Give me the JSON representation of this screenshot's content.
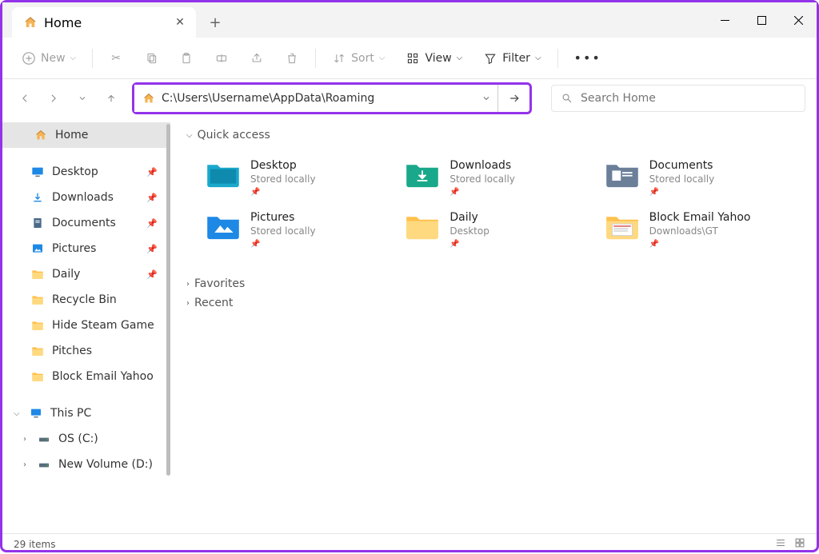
{
  "tab": {
    "title": "Home"
  },
  "toolbar": {
    "new": "New",
    "sort": "Sort",
    "view": "View",
    "filter": "Filter"
  },
  "address": {
    "path": "C:\\Users\\Username\\AppData\\Roaming"
  },
  "search": {
    "placeholder": "Search Home"
  },
  "sidebar": {
    "home": "Home",
    "pinned": [
      {
        "label": "Desktop",
        "icon": "desktop"
      },
      {
        "label": "Downloads",
        "icon": "downloads"
      },
      {
        "label": "Documents",
        "icon": "documents"
      },
      {
        "label": "Pictures",
        "icon": "pictures"
      },
      {
        "label": "Daily",
        "icon": "folder"
      }
    ],
    "folders": [
      {
        "label": "Recycle Bin"
      },
      {
        "label": "Hide Steam Game"
      },
      {
        "label": "Pitches"
      },
      {
        "label": "Block Email Yahoo"
      }
    ],
    "thispc": "This PC",
    "drives": [
      {
        "label": "OS (C:)"
      },
      {
        "label": "New Volume (D:)"
      }
    ]
  },
  "sections": {
    "quick": "Quick access",
    "favorites": "Favorites",
    "recent": "Recent"
  },
  "quick_items": [
    {
      "name": "Desktop",
      "sub": "Stored locally",
      "type": "desktop"
    },
    {
      "name": "Downloads",
      "sub": "Stored locally",
      "type": "downloads"
    },
    {
      "name": "Documents",
      "sub": "Stored locally",
      "type": "documents"
    },
    {
      "name": "Pictures",
      "sub": "Stored locally",
      "type": "pictures"
    },
    {
      "name": "Daily",
      "sub": "Desktop",
      "type": "folder"
    },
    {
      "name": "Block Email Yahoo",
      "sub": "Downloads\\GT",
      "type": "folder-thumb"
    }
  ],
  "status": {
    "count": "29 items"
  }
}
